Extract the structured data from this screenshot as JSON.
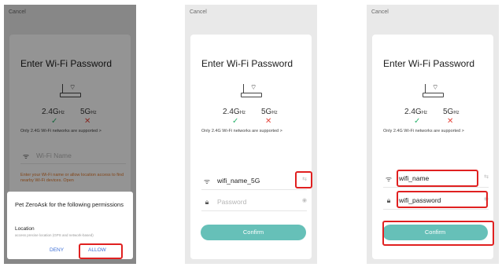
{
  "common": {
    "cancel_label": "Cancel",
    "title": "Enter Wi-Fi Password",
    "freq_24": "2.4G",
    "freq_5": "5G",
    "freq_unit": "Hz",
    "check_glyph": "✓",
    "cross_glyph": "✕",
    "only_text": "Only 2.4G Wi-Fi networks are supported >",
    "confirm_label": "Confirm"
  },
  "icons": {
    "wifi": "wifi-icon",
    "lock": "lock-icon",
    "eye": "eye-icon",
    "switch": "switch-arrows-icon",
    "router": "router-icon"
  },
  "screen1": {
    "wifi_placeholder": "Wi-Fi Name",
    "location_warning": "Enter your Wi-Fi name or allow location access to find nearby Wi-Fi devices. Open",
    "dialog_title": "Pet ZeroAsk for the following permissions",
    "dialog_item": "Location",
    "dialog_item_desc": "access precise location (GPS and network-based)",
    "deny_label": "DENY",
    "allow_label": "ALLOW"
  },
  "screen2": {
    "wifi_name": "wifi_name_5G",
    "password_placeholder": "Password"
  },
  "screen3": {
    "wifi_name": "wifi_name",
    "password": "wifi_password"
  },
  "colors": {
    "confirm": "#66c0b8",
    "highlight": "#e02020",
    "check": "#2bb36d",
    "cross": "#e6453b",
    "link": "#3d6fd6"
  }
}
